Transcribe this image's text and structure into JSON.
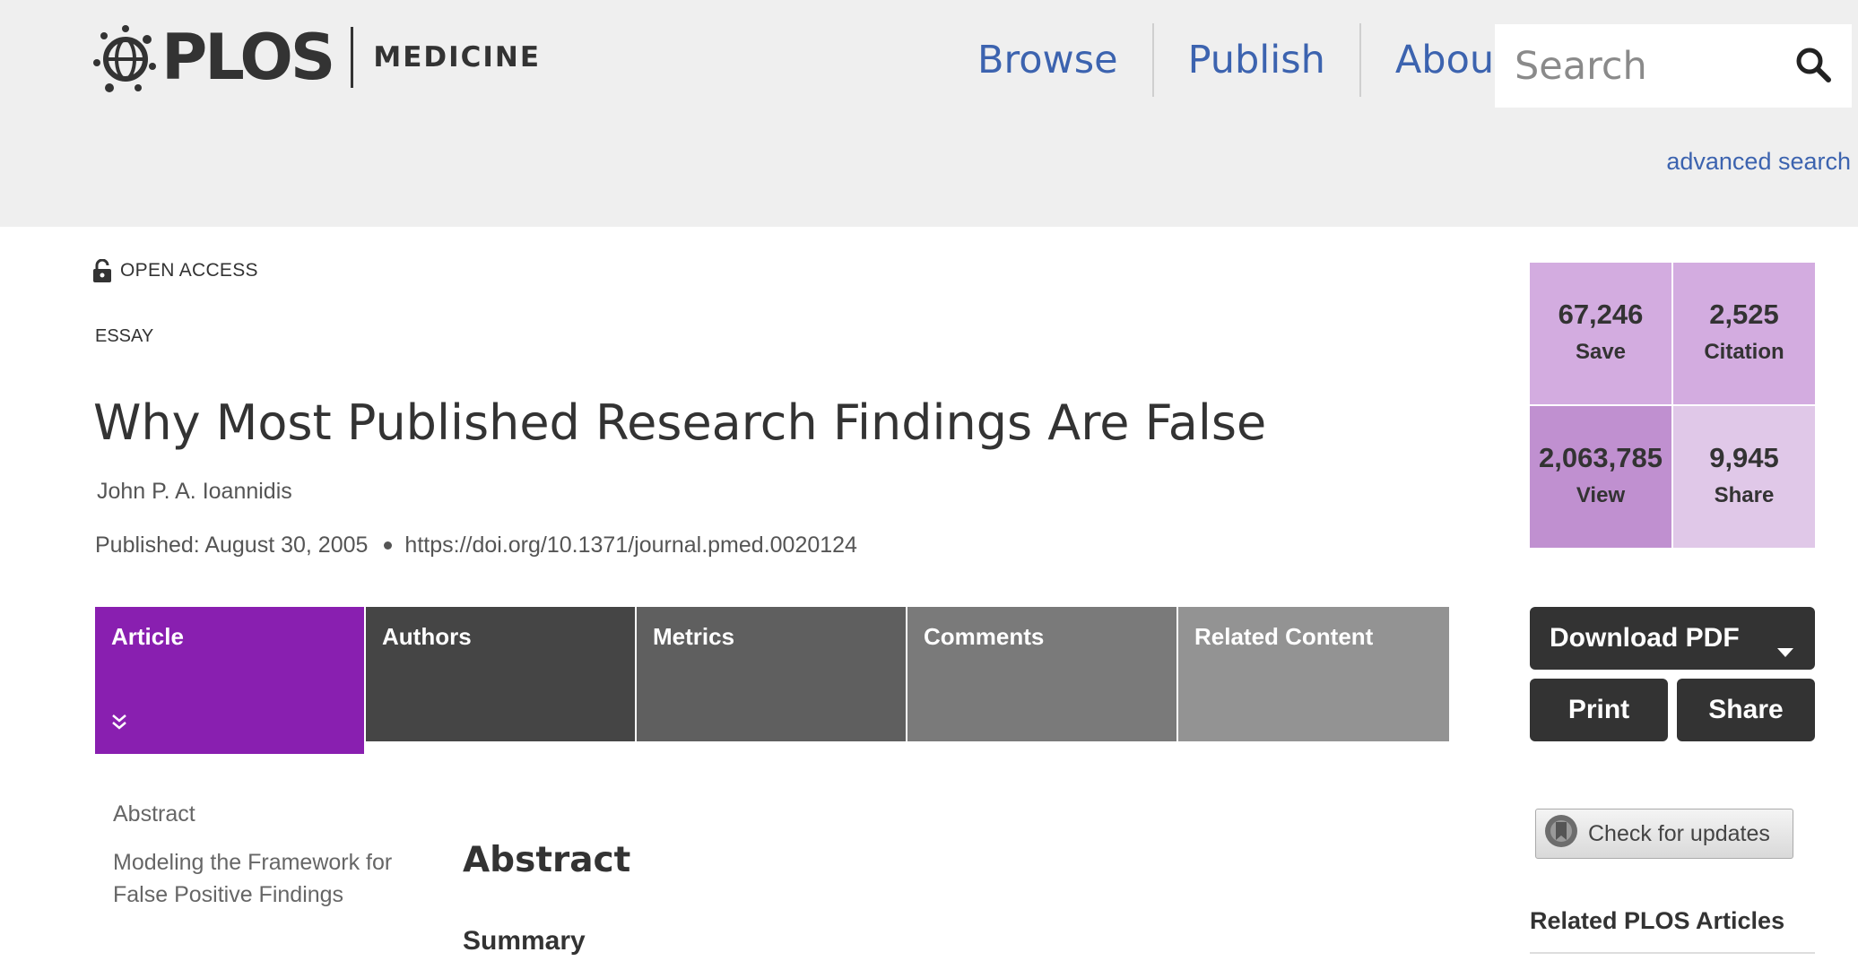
{
  "header": {
    "logo_text": "PLOS",
    "logo_sub": "MEDICINE",
    "nav": [
      {
        "label": "Browse"
      },
      {
        "label": "Publish"
      },
      {
        "label": "About"
      }
    ],
    "search": {
      "placeholder": "Search",
      "icon": "search-icon"
    },
    "advanced_search": "advanced search",
    "link_color": "#3c63af"
  },
  "article": {
    "open_access": "OPEN ACCESS",
    "type": "ESSAY",
    "title": "Why Most Published Research Findings Are False",
    "authors": "John P. A. Ioannidis",
    "published": "Published: August 30, 2005",
    "doi": "https://doi.org/10.1371/journal.pmed.0020124"
  },
  "tabs": [
    {
      "label": "Article",
      "active": true
    },
    {
      "label": "Authors"
    },
    {
      "label": "Metrics"
    },
    {
      "label": "Comments"
    },
    {
      "label": "Related Content"
    }
  ],
  "accent_color": "#891fb0",
  "toc": [
    {
      "label": "Abstract"
    },
    {
      "label": "Modeling the Framework for False Positive Findings"
    }
  ],
  "content": {
    "section_heading": "Abstract",
    "subheading": "Summary"
  },
  "metrics": {
    "save": {
      "value": "67,246",
      "label": "Save"
    },
    "citation": {
      "value": "2,525",
      "label": "Citation"
    },
    "view": {
      "value": "2,063,785",
      "label": "View"
    },
    "share": {
      "value": "9,945",
      "label": "Share"
    }
  },
  "actions": {
    "download_pdf": "Download PDF",
    "print": "Print",
    "share": "Share",
    "check_updates": "Check for updates"
  },
  "sidebar": {
    "related_title": "Related PLOS Articles"
  }
}
